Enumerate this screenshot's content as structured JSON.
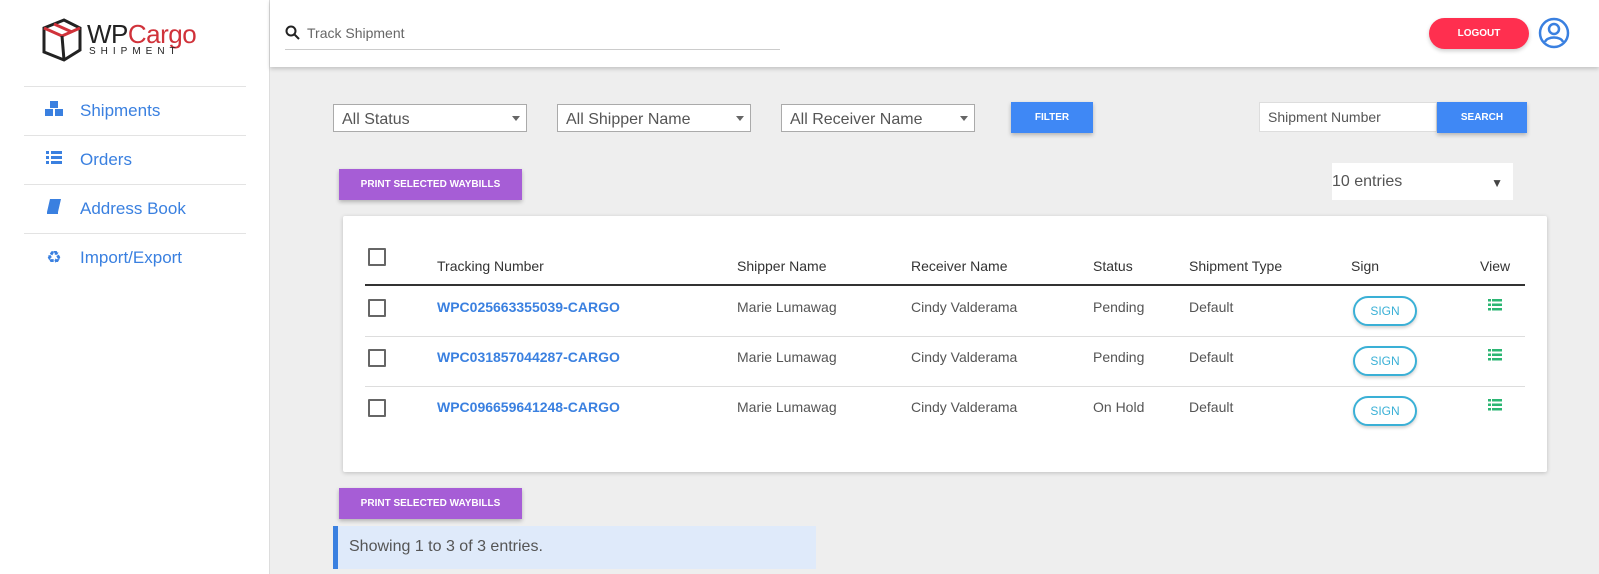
{
  "brand": {
    "wordmark_a": "WP",
    "wordmark_b": "Cargo",
    "subtitle": "SHIPMENT",
    "accent": "#d0323a"
  },
  "sidebar": {
    "items": [
      {
        "label": "Shipments",
        "icon": "cubes-icon"
      },
      {
        "label": "Orders",
        "icon": "list-icon"
      },
      {
        "label": "Address Book",
        "icon": "book-icon"
      },
      {
        "label": "Import/Export",
        "icon": "recycle-icon"
      }
    ]
  },
  "topbar": {
    "track_placeholder": "Track Shipment",
    "logout_label": "LOGOUT"
  },
  "filters": {
    "status": "All Status",
    "shipper": "All Shipper Name",
    "receiver": "All Receiver Name",
    "filter_label": "FILTER",
    "shipment_number_placeholder": "Shipment Number",
    "search_label": "SEARCH"
  },
  "actions": {
    "print_label": "PRINT SELECTED WAYBILLS",
    "entries": "10 entries"
  },
  "table": {
    "headers": [
      "Tracking Number",
      "Shipper Name",
      "Receiver Name",
      "Status",
      "Shipment Type",
      "Sign",
      "View"
    ],
    "rows": [
      {
        "tracking": "WPC025663355039-CARGO",
        "shipper": "Marie Lumawag",
        "receiver": "Cindy Valderama",
        "status": "Pending",
        "type": "Default",
        "sign": "SIGN"
      },
      {
        "tracking": "WPC031857044287-CARGO",
        "shipper": "Marie Lumawag",
        "receiver": "Cindy Valderama",
        "status": "Pending",
        "type": "Default",
        "sign": "SIGN"
      },
      {
        "tracking": "WPC096659641248-CARGO",
        "shipper": "Marie Lumawag",
        "receiver": "Cindy Valderama",
        "status": "On Hold",
        "type": "Default",
        "sign": "SIGN"
      }
    ]
  },
  "footer": {
    "showing": "Showing 1 to 3 of 3 entries."
  },
  "colors": {
    "primary": "#3f88f5",
    "purple": "#a65dd6",
    "logout": "#ff2f4f",
    "sign": "#3ab0d6",
    "view": "#2bb673"
  }
}
